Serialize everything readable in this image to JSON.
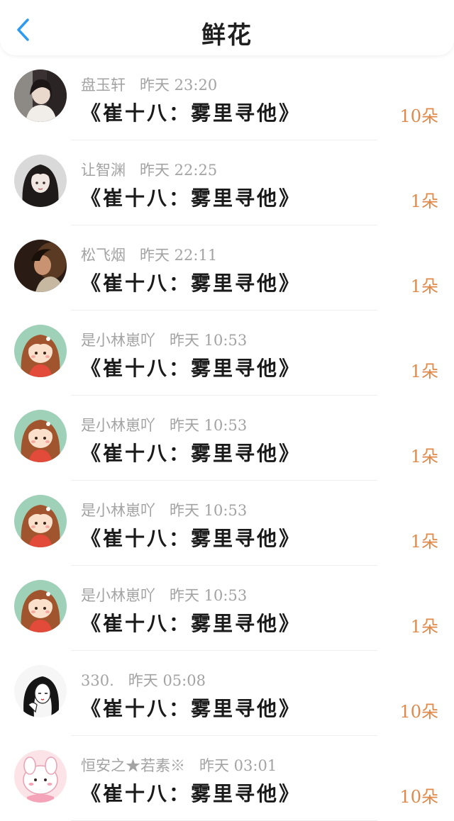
{
  "header": {
    "title": "鲜花",
    "back_icon": "chevron-left-icon",
    "accent": "#2f9bf0"
  },
  "count_color": "#e0894a",
  "items": [
    {
      "name": "盘玉轩",
      "time": "昨天 23:20",
      "book": "《崔十八：雾里寻他》",
      "count": "10朵",
      "avatar": "girl-photo-avatar"
    },
    {
      "name": "让智渊",
      "time": "昨天 22:25",
      "book": "《崔十八：雾里寻他》",
      "count": "1朵",
      "avatar": "dark-hair-girl-avatar"
    },
    {
      "name": "松飞烟",
      "time": "昨天 22:11",
      "book": "《崔十八：雾里寻他》",
      "count": "1朵",
      "avatar": "night-photo-avatar"
    },
    {
      "name": "是小林崽吖",
      "time": "昨天 10:53",
      "book": "《崔十八：雾里寻他》",
      "count": "1朵",
      "avatar": "cartoon-girl-avatar"
    },
    {
      "name": "是小林崽吖",
      "time": "昨天 10:53",
      "book": "《崔十八：雾里寻他》",
      "count": "1朵",
      "avatar": "cartoon-girl-avatar"
    },
    {
      "name": "是小林崽吖",
      "time": "昨天 10:53",
      "book": "《崔十八：雾里寻他》",
      "count": "1朵",
      "avatar": "cartoon-girl-avatar"
    },
    {
      "name": "是小林崽吖",
      "time": "昨天 10:53",
      "book": "《崔十八：雾里寻他》",
      "count": "1朵",
      "avatar": "cartoon-girl-avatar"
    },
    {
      "name": "330.",
      "time": "昨天 05:08",
      "book": "《崔十八：雾里寻他》",
      "count": "10朵",
      "avatar": "sketch-girl-avatar"
    },
    {
      "name": "恒安之★若素※",
      "time": "昨天 03:01",
      "book": "《崔十八：雾里寻他》",
      "count": "10朵",
      "avatar": "pink-bunny-avatar"
    }
  ]
}
